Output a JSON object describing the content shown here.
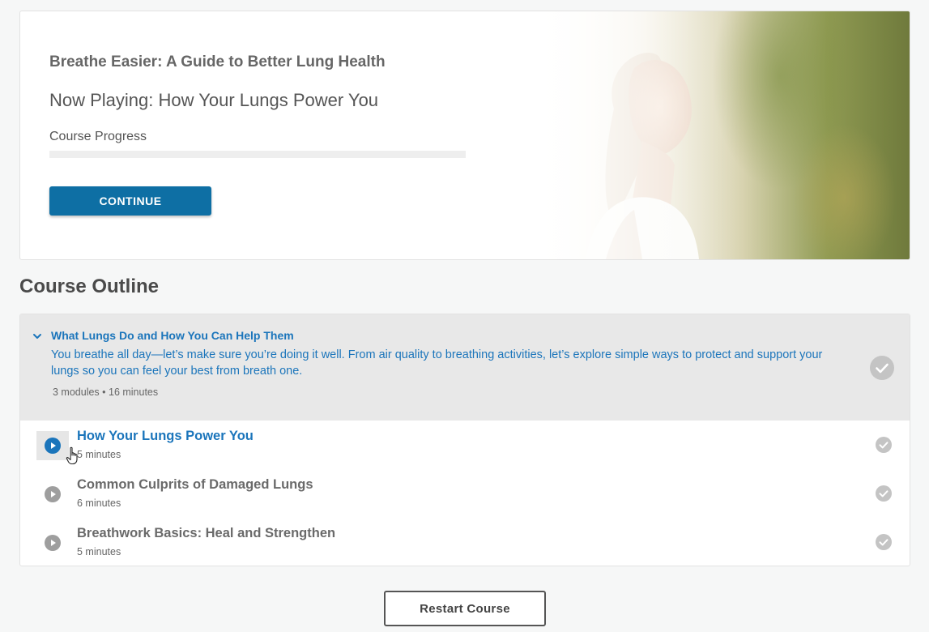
{
  "hero": {
    "course_title": "Breathe Easier: A Guide to Better Lung Health",
    "now_playing": "Now Playing: How Your Lungs Power You",
    "progress_label": "Course Progress",
    "progress_percent": 0,
    "continue_label": "CONTINUE"
  },
  "outline": {
    "heading": "Course Outline",
    "section": {
      "title": "What Lungs Do and How You Can Help Them",
      "description": "You breathe all day—let’s make sure you’re doing it well. From air quality to breathing activities, let’s explore simple ways to protect and support your lungs so you can feel your best from breath one.",
      "meta": "3 modules • 16 minutes",
      "expanded": true
    },
    "modules": [
      {
        "title": "How Your Lungs Power You",
        "duration": "5 minutes",
        "active": true
      },
      {
        "title": "Common Culprits of Damaged Lungs",
        "duration": "6 minutes",
        "active": false
      },
      {
        "title": "Breathwork Basics: Heal and Strengthen",
        "duration": "5 minutes",
        "active": false
      }
    ]
  },
  "restart_label": "Restart Course",
  "colors": {
    "accent": "#1b75bb",
    "button": "#0e6fa4",
    "check": "#bdbdbd",
    "play_inactive": "#9e9e9e"
  }
}
